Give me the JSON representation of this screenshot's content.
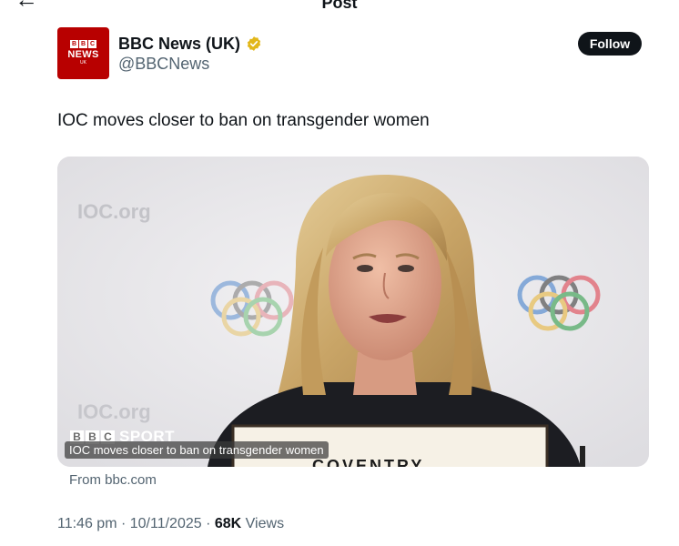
{
  "topbar": {
    "title": "Post",
    "back_icon": "←",
    "more_icon": "⋮"
  },
  "author": {
    "display_name": "BBC News (UK)",
    "handle": "@BBCNews",
    "verified_color": "#e2b719",
    "avatar": {
      "letters": [
        "B",
        "B",
        "C"
      ],
      "word": "NEWS",
      "region": "UK",
      "color": "#b80000"
    }
  },
  "follow_label": "Follow",
  "tweet_text": "IOC moves closer to ban on transgender women",
  "media": {
    "caption": "IOC moves closer to ban on transgender women",
    "badge_letters": [
      "B",
      "B",
      "C"
    ],
    "badge_word": "SPORT",
    "backdrop_text": "IOC.org",
    "nameplate_text": "COVENTRY"
  },
  "link_source": "From bbc.com",
  "meta": {
    "time": "11:46 pm",
    "separator": " · ",
    "date": "10/11/2025",
    "views_count": "68K",
    "views_label": "Views"
  }
}
